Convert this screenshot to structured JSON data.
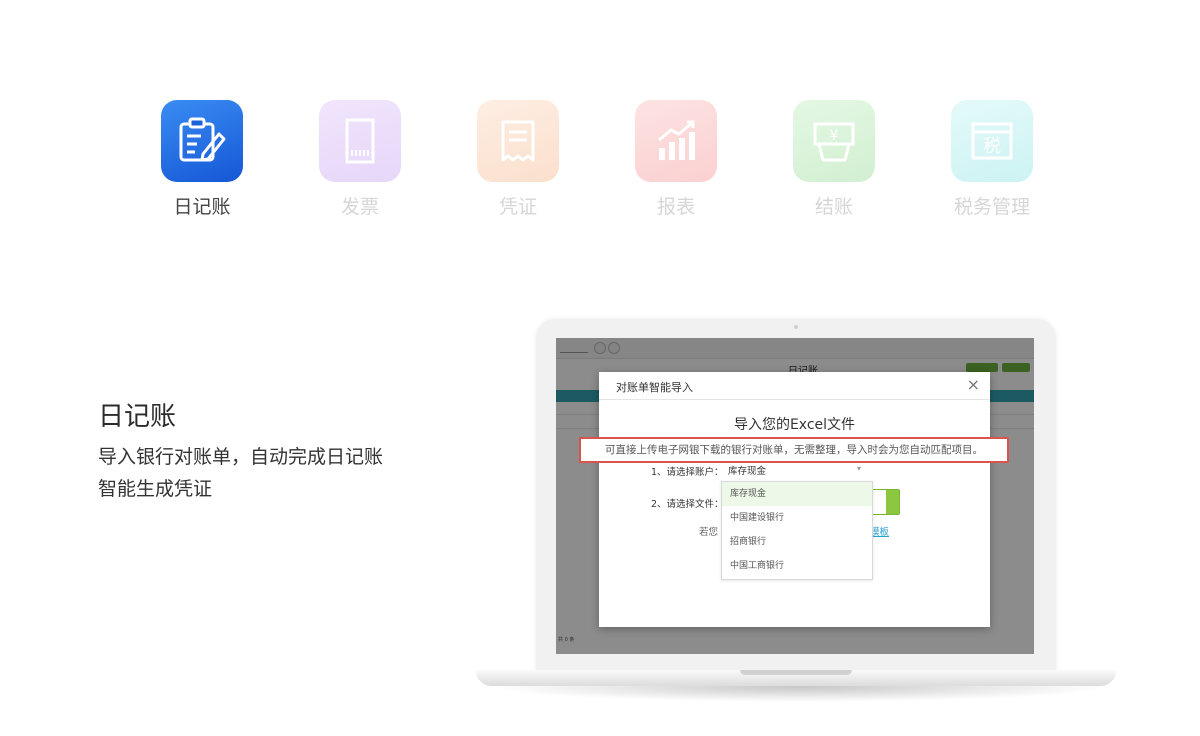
{
  "tabs": [
    {
      "label": "日记账",
      "icon": "journal-edit-icon",
      "color": "#1f6fe0",
      "active": true
    },
    {
      "label": "发票",
      "icon": "invoice-icon",
      "color": "#c49af0",
      "active": false
    },
    {
      "label": "凭证",
      "icon": "voucher-receipt-icon",
      "color": "#f7b98a",
      "active": false
    },
    {
      "label": "报表",
      "icon": "report-chart-icon",
      "color": "#f78d8d",
      "active": false
    },
    {
      "label": "结账",
      "icon": "checkout-register-icon",
      "color": "#8fdc8f",
      "active": false
    },
    {
      "label": "税务管理",
      "icon": "tax-icon",
      "color": "#8ae6e6",
      "active": false
    }
  ],
  "tax_icon_char": "税",
  "description": {
    "title": "日记账",
    "lines": [
      "导入银行对账单，自动完成日记账",
      "智能生成凭证"
    ]
  },
  "app": {
    "page_title": "日记账",
    "footer": "共 0 条"
  },
  "modal": {
    "title": "对账单智能导入",
    "close": "×",
    "heading": "导入您的Excel文件",
    "callout": "可直接上传电子网银下载的银行对账单，无需整理，导入时会为您自动匹配项目。",
    "account_label": "1、请选择账户：",
    "account_value": "库存现金",
    "file_label": "2、请选择文件：",
    "hint_prefix": "若您",
    "hint_link": "模板"
  },
  "dropdown": {
    "options": [
      "库存现金",
      "中国建设银行",
      "招商银行",
      "中国工商银行"
    ],
    "selected": 0
  }
}
